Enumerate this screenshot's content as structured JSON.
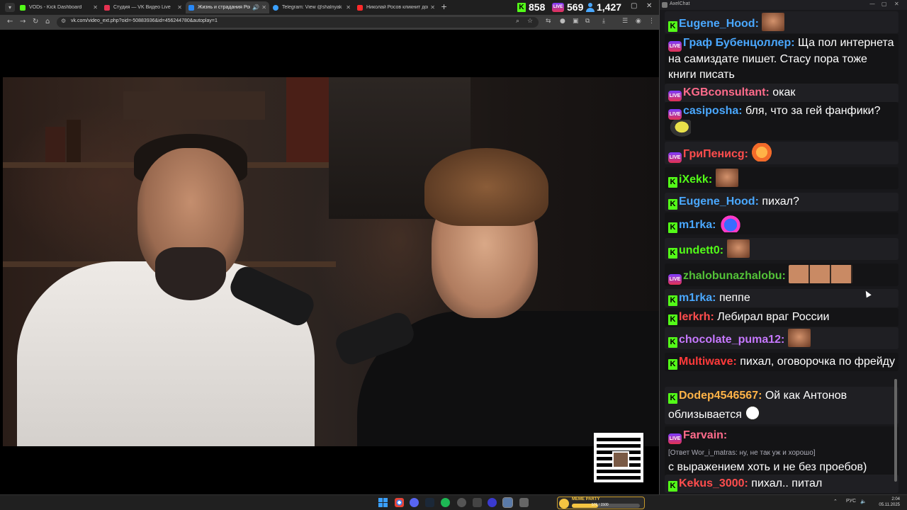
{
  "browser": {
    "tabs": [
      {
        "label": "VODs - Kick Dashboard",
        "icon": "kick-icon",
        "color": "#53fc18",
        "active": false
      },
      {
        "label": "Студия — VK Видео Live",
        "icon": "vk-live-icon",
        "color": "#e53251",
        "active": false
      },
      {
        "label": "Жизнь и страдания Рома...",
        "icon": "vk-icon",
        "color": "#2787f5",
        "active": true
      },
      {
        "label": "Telegram: View @shalnyak",
        "icon": "telegram-icon",
        "color": "#3aa0ff",
        "active": false
      },
      {
        "label": "Николай Росов кликнит дома...",
        "icon": "youtube-icon",
        "color": "#ff2a2a",
        "active": false
      }
    ],
    "url": "vk.com/video_ext.php?oid=-50883936&id=456244780&autoplay=1"
  },
  "stats": {
    "kick_viewers": "858",
    "vk_viewers": "569",
    "total_viewers": "1,427"
  },
  "chat": {
    "title": "AxelChat",
    "messages": [
      {
        "platform": "kick",
        "user": "Eugene_Hood:",
        "color": "#4aa8ff",
        "text": "",
        "emote": "face"
      },
      {
        "platform": "live",
        "user": "Граф Бубенцоллер:",
        "color": "#4aa8ff",
        "text": "Ща пол интернета на самиздате пишет. Стасу пора тоже книги писать"
      },
      {
        "platform": "live",
        "user": "KGBconsultant:",
        "color": "#ff6b8b",
        "text": "окак"
      },
      {
        "platform": "live",
        "user": "casiposha:",
        "color": "#4aa8ff",
        "text": "бля, что за гей фанфики?",
        "emote": "bird"
      },
      {
        "platform": "live",
        "user": "ГриПенисg:",
        "color": "#ff4d4d",
        "text": "",
        "emote": "smile"
      },
      {
        "platform": "kick",
        "user": "iXekk:",
        "color": "#53fc18",
        "text": "",
        "emote": "face"
      },
      {
        "platform": "kick",
        "user": "Eugene_Hood:",
        "color": "#4aa8ff",
        "text": "пихал?"
      },
      {
        "platform": "kick",
        "user": "m1rka:",
        "color": "#4aa8ff",
        "text": "",
        "emote": "pepe"
      },
      {
        "platform": "kick",
        "user": "undett0:",
        "color": "#53fc18",
        "text": "",
        "emote": "face"
      },
      {
        "platform": "live",
        "user": "zhalobunazhalobu:",
        "color": "#53c238",
        "text": "",
        "emote": "face3"
      },
      {
        "platform": "kick",
        "user": "m1rka:",
        "color": "#4aa8ff",
        "text": "пеппе"
      },
      {
        "platform": "kick",
        "user": "lerkrh:",
        "color": "#ff4d4d",
        "text": "Лебирал враг России"
      },
      {
        "platform": "kick",
        "user": "chocolate_puma12:",
        "color": "#c678ff",
        "text": "",
        "emote": "face"
      },
      {
        "platform": "kick",
        "user": "Multiwave:",
        "color": "#ff3a3a",
        "text": "пихал, оговорочка по фрейду"
      },
      {
        "platform": "kick",
        "user": "Dodep4546567:",
        "color": "#ffb347",
        "text": "Ой как Антонов облизывается",
        "emote": "joker"
      },
      {
        "platform": "live",
        "user": "Farvain:",
        "color": "#ff6b8b",
        "text": "с выражением хоть и не без проебов)",
        "reply": "[Ответ Wor_i_matras: ну, не так уж и хорошо]"
      },
      {
        "platform": "kick",
        "user": "Kekus_3000:",
        "color": "#ff4d4d",
        "text": "пихал.. питал"
      }
    ]
  },
  "taskbar": {
    "meme_title": "MEME PARTY",
    "meme_value": "576 / 1500",
    "meme_progress": 0.384,
    "lang": "РУС",
    "time": "2:04",
    "date": "05.11.2025"
  }
}
